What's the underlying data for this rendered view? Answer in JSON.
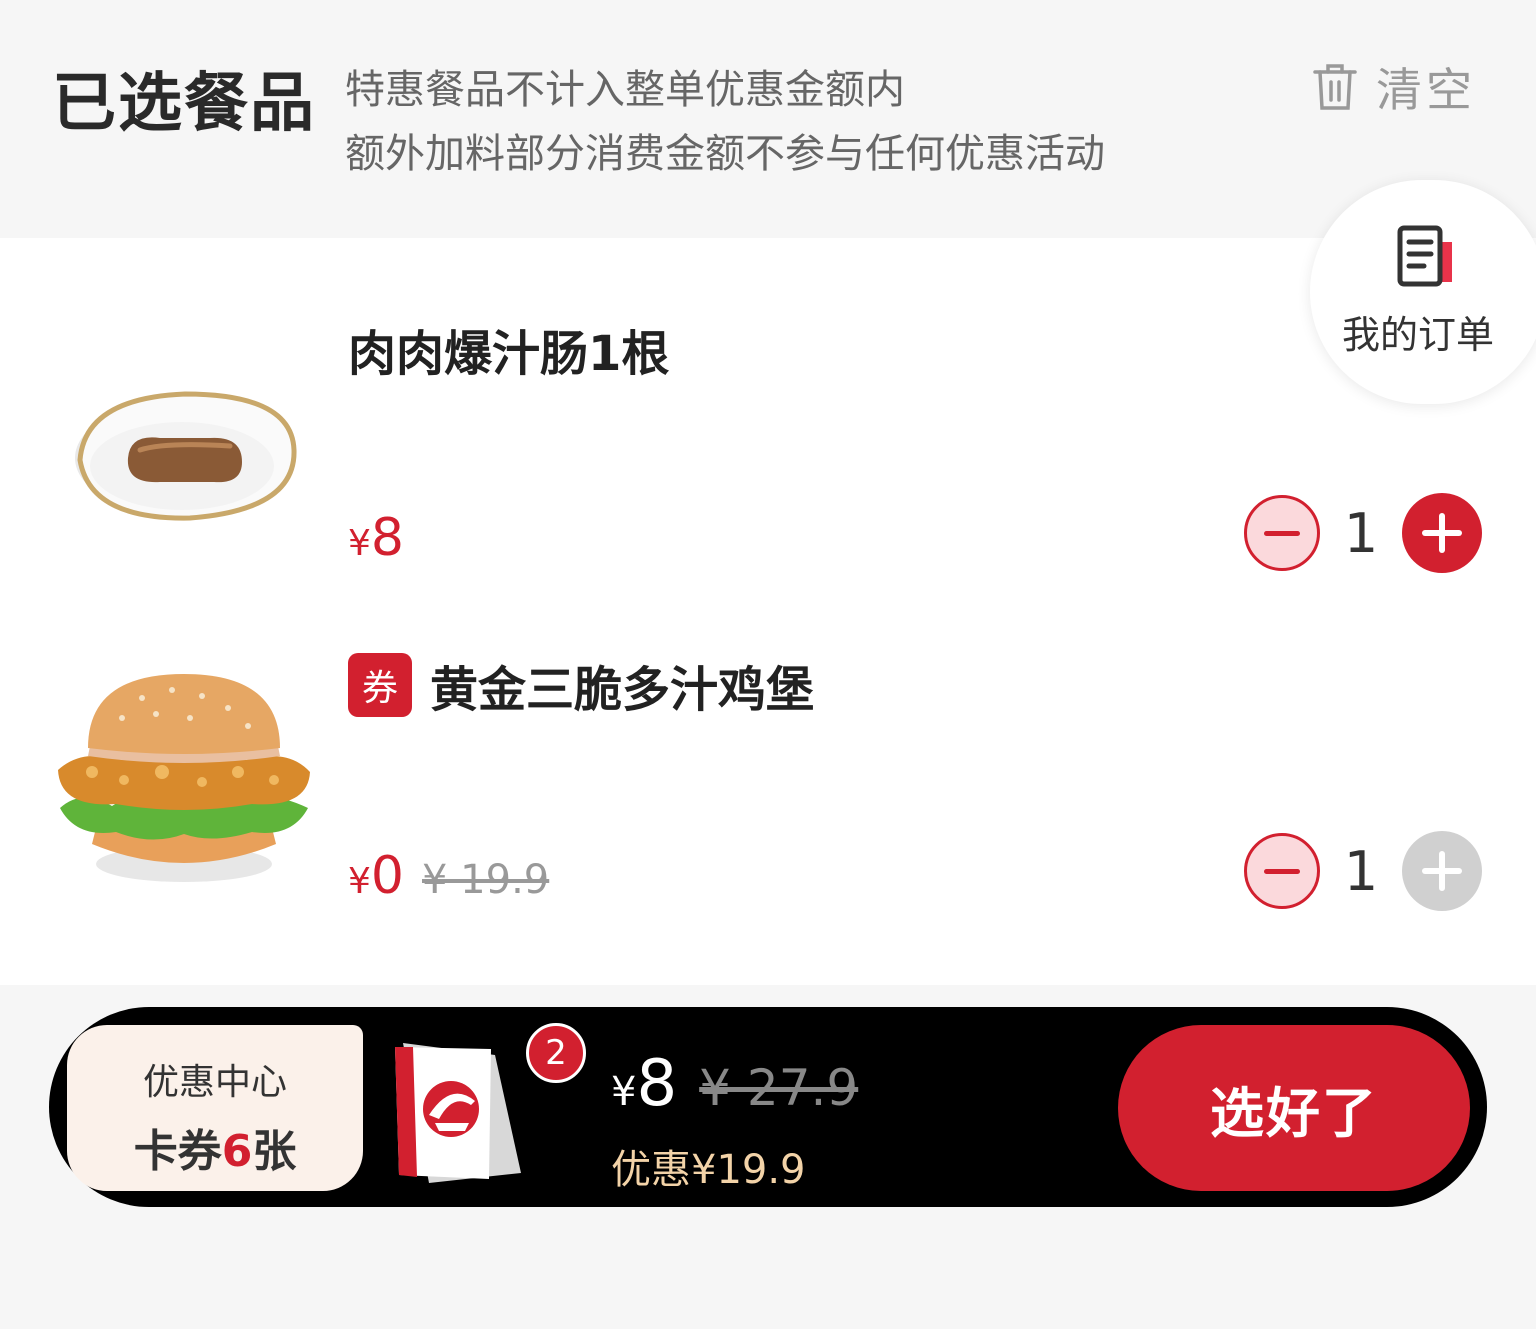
{
  "header": {
    "title": "已选餐品",
    "notes": [
      "特惠餐品不计入整单优惠金额内",
      "额外加料部分消费金额不参与任何优惠活动"
    ],
    "clear_label": "清空",
    "clear_icon": "trash-icon"
  },
  "my_orders": {
    "label": "我的订单",
    "icon": "order-list-icon"
  },
  "items": [
    {
      "name": "肉肉爆汁肠1根",
      "currency": "¥",
      "price": "8",
      "quantity": "1",
      "image": "sausage-image"
    },
    {
      "tag": "券",
      "name": "黄金三脆多汁鸡堡",
      "currency": "¥",
      "price": "0",
      "original_price": "¥ 19.9",
      "quantity": "1",
      "image": "burger-image"
    }
  ],
  "cart": {
    "promo_title": "优惠中心",
    "promo_prefix": "卡券",
    "promo_count": "6",
    "promo_suffix": "张",
    "badge": "2",
    "currency": "¥",
    "total": "8",
    "original_total": "¥ 27.9",
    "discount": "优惠¥19.9",
    "checkout_label": "选好了"
  },
  "colors": {
    "accent": "#d2202f",
    "bar": "#000000",
    "discount": "#f3d3a8"
  }
}
